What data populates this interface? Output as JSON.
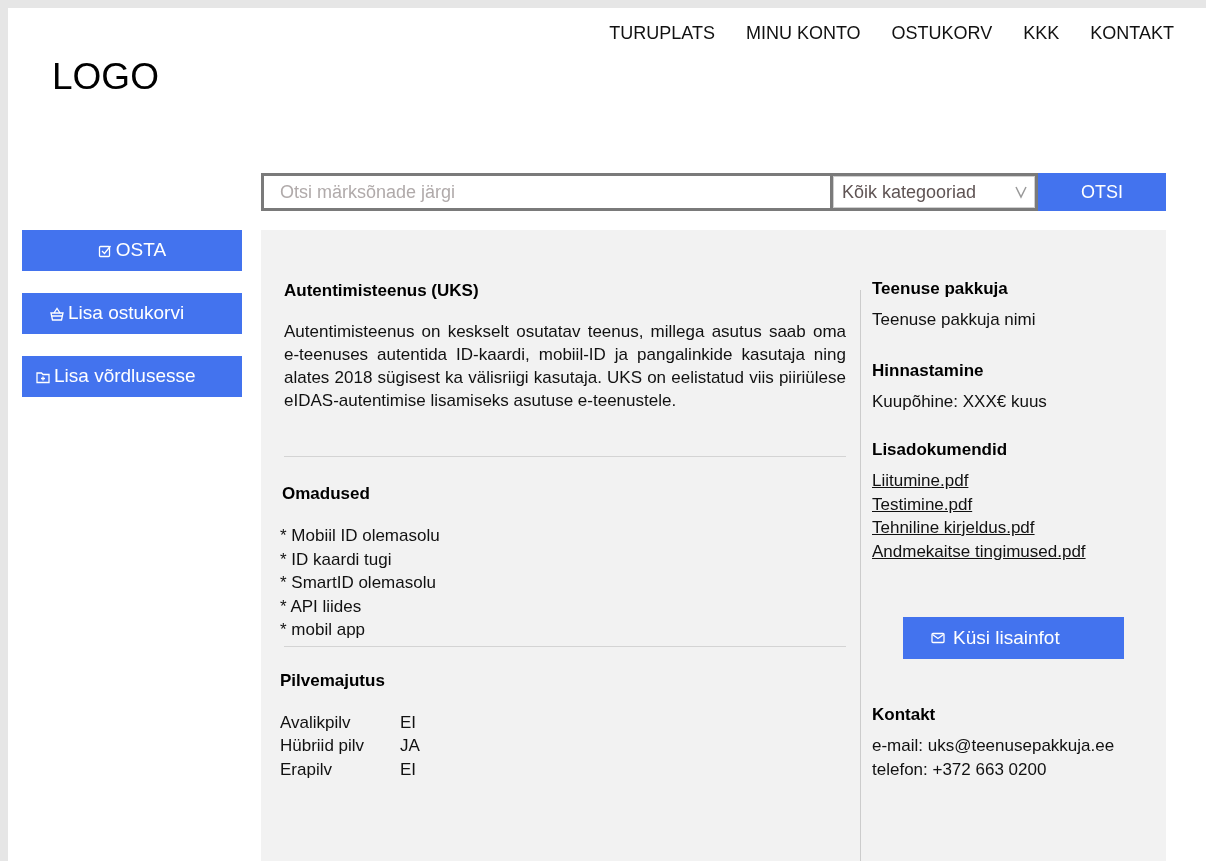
{
  "logo": "LOGO",
  "nav": [
    "TURUPLATS",
    "MINU KONTO",
    "OSTUKORV",
    "KKK",
    "KONTAKT"
  ],
  "search": {
    "placeholder": "Otsi märksõnade järgi",
    "category": "Kõik kategooriad",
    "button": "OTSI"
  },
  "actions": [
    {
      "label": "OSTA",
      "kind": "check"
    },
    {
      "label": "Lisa ostukorvi",
      "kind": "basket"
    },
    {
      "label": "Lisa võrdlusesse",
      "kind": "folder"
    }
  ],
  "service": {
    "title": "Autentimisteenus (UKS)",
    "description": "Autentimisteenus on keskselt osutatav teenus, millega asutus saab oma e-teenuses autentida ID-kaardi, mobiil-ID ja pangalinkide kasutaja ning alates 2018 sügisest ka välisriigi kasutaja. UKS on eelistatud viis piiriülese eIDAS-autentimise lisamiseks asutuse e-teenustele."
  },
  "features": {
    "title": "Omadused",
    "items": [
      "* Mobiil ID olemasolu",
      "* ID kaardi tugi",
      "* SmartID olemasolu",
      "* API liides",
      "* mobil app"
    ]
  },
  "hosting": {
    "title": "Pilvemajutus",
    "rows": [
      {
        "label": "Avalikpilv",
        "value": "EI"
      },
      {
        "label": "Hübriid pilv",
        "value": "JA"
      },
      {
        "label": "Erapilv",
        "value": "EI"
      }
    ]
  },
  "provider": {
    "title": "Teenuse pakkuja",
    "name": "Teenuse pakkuja nimi"
  },
  "pricing": {
    "title": "Hinnastamine",
    "text": "Kuupõhine: XXX€ kuus"
  },
  "documents": {
    "title": "Lisadokumendid",
    "links": [
      "Liitumine.pdf",
      "Testimine.pdf",
      "Tehniline kirjeldus.pdf",
      "Andmekaitse tingimused.pdf"
    ]
  },
  "inquiry_button": "Küsi lisainfot",
  "contact": {
    "title": "Kontakt",
    "lines": [
      "e-mail: uks@teenusepakkuja.ee",
      "telefon: +372 663 0200"
    ]
  }
}
